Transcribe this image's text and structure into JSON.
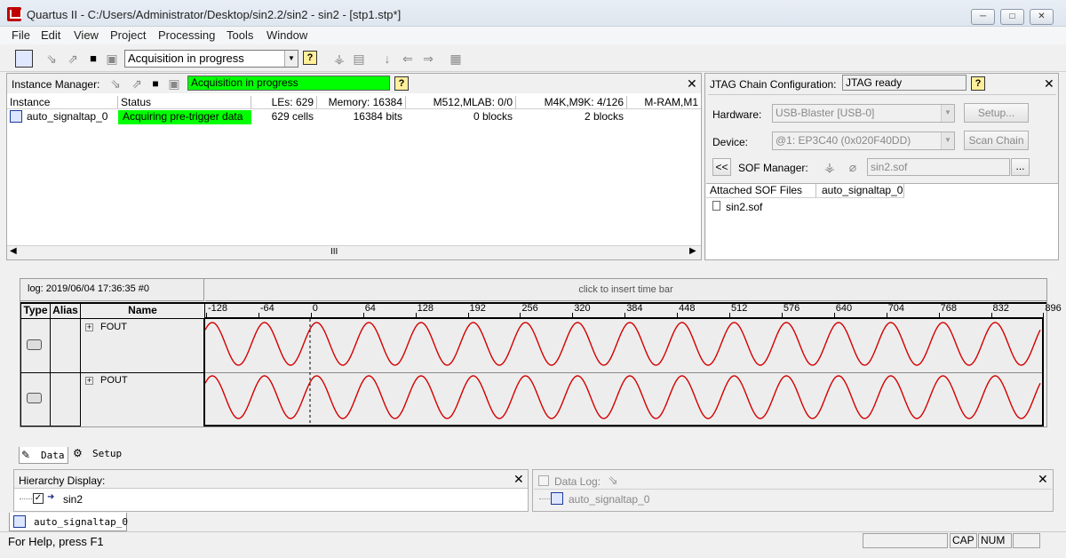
{
  "window": {
    "title": "Quartus II - C:/Users/Administrator/Desktop/sin2.2/sin2 - sin2 - [stp1.stp*]",
    "minimize": "─",
    "maximize": "□",
    "close": "✕"
  },
  "menu": [
    "File",
    "Edit",
    "View",
    "Project",
    "Processing",
    "Tools",
    "Window"
  ],
  "toolbar": {
    "status_combo": "Acquisition in progress",
    "help": "?"
  },
  "instance_manager": {
    "label": "Instance Manager:",
    "status": "Acquisition in progress",
    "help": "?",
    "close": "✕",
    "columns": [
      "Instance",
      "Status",
      "LEs: 629",
      "Memory: 16384",
      "M512,MLAB: 0/0",
      "M4K,M9K: 4/126",
      "M-RAM,M1"
    ],
    "rows": [
      {
        "instance": "auto_signaltap_0",
        "status": "Acquiring pre-trigger data",
        "les": "629 cells",
        "memory": "16384 bits",
        "m512": "0 blocks",
        "m4k": "2 blocks"
      }
    ],
    "scroll_mid": "III"
  },
  "jtag": {
    "label": "JTAG Chain Configuration:",
    "status": "JTAG ready",
    "help": "?",
    "close": "✕",
    "hardware_label": "Hardware:",
    "hardware_value": "USB-Blaster [USB-0]",
    "setup_button": "Setup...",
    "device_label": "Device:",
    "device_value": "@1: EP3C40 (0x020F40DD)",
    "scan_button": "Scan Chain",
    "collapse_button": "<<",
    "sof_label": "SOF Manager:",
    "sof_value": "sin2.sof",
    "browse_button": "...",
    "attached_header": "Attached SOF Files",
    "instance_header": "auto_signaltap_0",
    "attached_file": "sin2.sof"
  },
  "waveform": {
    "log_label": "log: 2019/06/04 17:36:35  #0",
    "time_bar_hint": "click to insert time bar",
    "columns": {
      "type": "Type",
      "alias": "Alias",
      "name": "Name"
    },
    "ticks": [
      "-128",
      "-64",
      "0",
      "64",
      "128",
      "192",
      "256",
      "320",
      "384",
      "448",
      "512",
      "576",
      "640",
      "704",
      "768",
      "832",
      "896"
    ],
    "signals": [
      {
        "name": "FOUT",
        "color": "#d40000",
        "cycles": 16
      },
      {
        "name": "POUT",
        "color": "#d40000",
        "cycles": 16
      }
    ],
    "expand": "+"
  },
  "tabs": {
    "data": "Data",
    "setup": "Setup"
  },
  "hierarchy": {
    "label": "Hierarchy Display:",
    "close": "✕",
    "item": "sin2"
  },
  "data_log": {
    "label": "Data Log:",
    "close": "✕",
    "item": "auto_signaltap_0"
  },
  "bottom_tab": "auto_signaltap_0",
  "statusbar": {
    "help": "For Help, press F1",
    "cap": "CAP",
    "num": "NUM"
  },
  "colors": {
    "status_green": "#00ff00",
    "wave_red": "#d40000"
  }
}
